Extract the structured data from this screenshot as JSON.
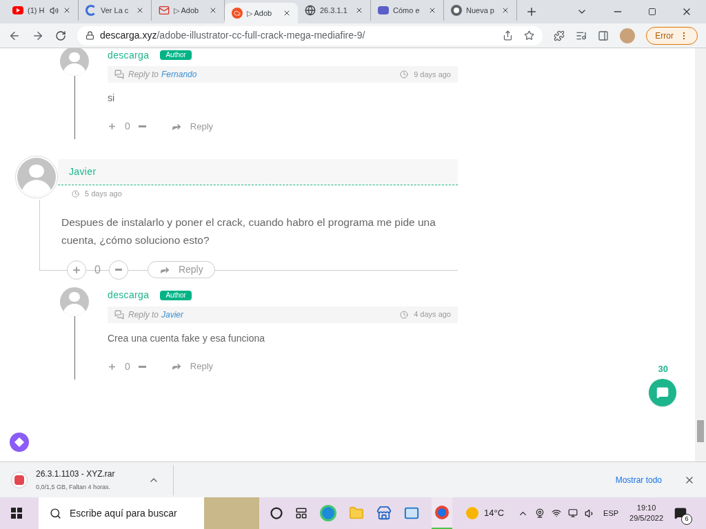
{
  "browser": {
    "tabs": [
      {
        "title": "(1) H",
        "selected": false,
        "audio": true,
        "kind": "video"
      },
      {
        "title": "Ver La c",
        "selected": false,
        "audio": false,
        "kind": "c"
      },
      {
        "title": "▷ Adob",
        "selected": false,
        "audio": false,
        "kind": "mail"
      },
      {
        "title": "▷ Adob",
        "selected": true,
        "audio": false,
        "kind": "cloud"
      },
      {
        "title": "26.3.1.1",
        "selected": false,
        "audio": false,
        "kind": "globe"
      },
      {
        "title": "Cómo e",
        "selected": false,
        "audio": false,
        "kind": "rz"
      },
      {
        "title": "Nueva p",
        "selected": false,
        "audio": false,
        "kind": "chrome"
      }
    ],
    "url_domain": "descarga.xyz",
    "url_path": "/adobe-illustrator-cc-full-crack-mega-mediafire-9/",
    "profile_button": "Error"
  },
  "comments": [
    {
      "kind": "reply",
      "author": "descarga",
      "badge": "Author",
      "reply_to_label": "Reply to",
      "reply_to": "Fernando",
      "time": "9 days ago",
      "text": "si",
      "votes": "0",
      "reply_button": "Reply"
    },
    {
      "kind": "comment",
      "author": "Javier",
      "time": "5 days ago",
      "text": "Despues de instalarlo y poner el crack, cuando habro el programa me pide una cuenta, ¿cómo soluciono esto?",
      "votes": "0",
      "reply_button": "Reply"
    },
    {
      "kind": "reply",
      "author": "descarga",
      "badge": "Author",
      "reply_to_label": "Reply to",
      "reply_to": "Javier",
      "time": "4 days ago",
      "text": "Crea una cuenta fake y esa funciona",
      "votes": "0",
      "reply_button": "Reply"
    }
  ],
  "comment_count": "30",
  "download_bar": {
    "file": "26.3.1.1103 - XYZ.rar",
    "status": "0,0/1,5 GB, Faltan 4 horas.",
    "show_all": "Mostrar todo"
  },
  "taskbar": {
    "search_placeholder": "Escribe aquí para buscar",
    "temperature": "14°C",
    "language": "ESP",
    "time": "19:10",
    "date": "29/5/2022",
    "notifications": "6"
  }
}
